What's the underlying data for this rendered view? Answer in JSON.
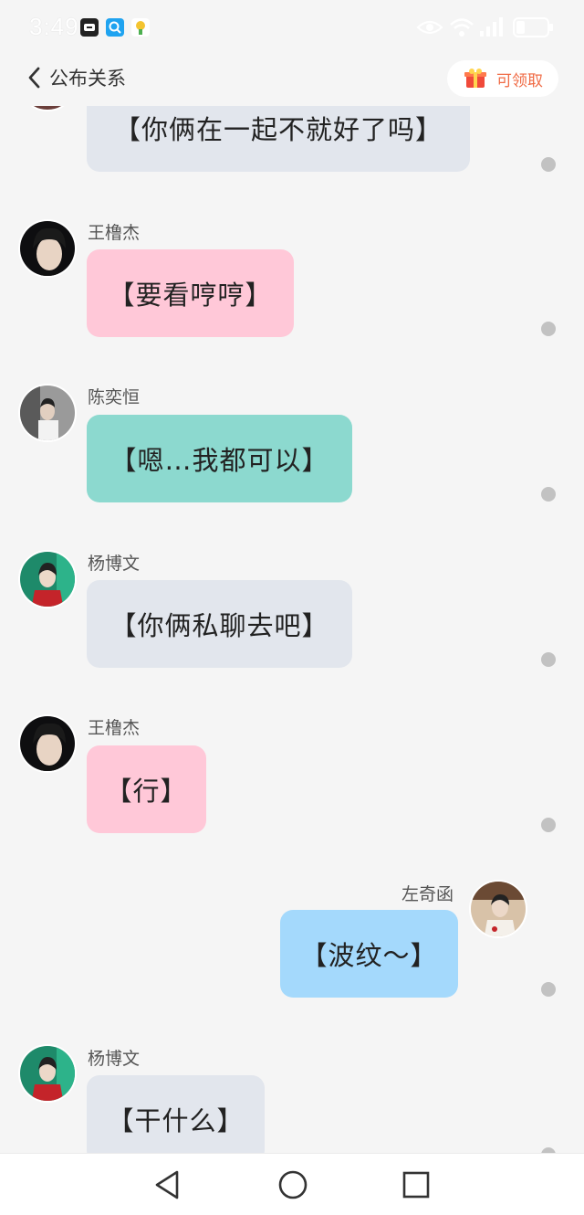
{
  "status_bar": {
    "time": "3:49",
    "app_icons": [
      "app-notification-icon",
      "search-app-icon",
      "lottery-app-icon"
    ],
    "indicators": [
      "eye-icon",
      "wifi-icon",
      "signal-icon",
      "battery-icon"
    ]
  },
  "header": {
    "title": "公布关系",
    "claim_label": "可领取"
  },
  "messages": [
    {
      "sender": "",
      "text": "【你俩在一起不就好了吗】",
      "color": "#e2e6ed"
    },
    {
      "sender": "王橹杰",
      "text": "【要看哼哼】",
      "color": "#ffc8d8"
    },
    {
      "sender": "陈奕恒",
      "text": "【嗯…我都可以】",
      "color": "#8cd9cf"
    },
    {
      "sender": "杨博文",
      "text": "【你俩私聊去吧】",
      "color": "#e2e6ed"
    },
    {
      "sender": "王橹杰",
      "text": "【行】",
      "color": "#ffc8d8"
    },
    {
      "sender": "左奇函",
      "text": "【波纹～】",
      "color": "#a4d9fc"
    },
    {
      "sender": "杨博文",
      "text": "【干什么】",
      "color": "#e2e6ed"
    }
  ],
  "nav": {
    "back": "back-triangle-icon",
    "home": "home-circle-icon",
    "recents": "recents-square-icon"
  }
}
